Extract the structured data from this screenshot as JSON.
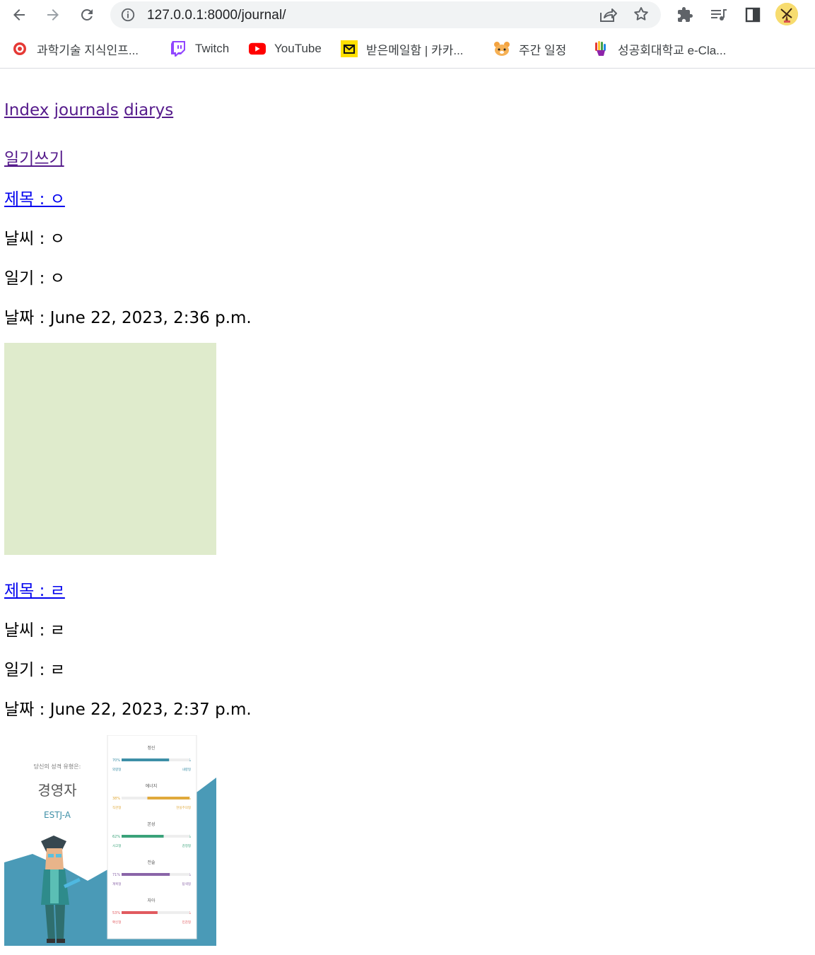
{
  "browser": {
    "url": "127.0.0.1:8000/journal/",
    "bookmarks": [
      {
        "label": "과학기술 지식인프...",
        "icon": "science-knowledge-icon"
      },
      {
        "label": "Twitch",
        "icon": "twitch-icon"
      },
      {
        "label": "YouTube",
        "icon": "youtube-icon"
      },
      {
        "label": "받은메일함 | 카카...",
        "icon": "kakao-mail-icon"
      },
      {
        "label": "주간 일정",
        "icon": "hamster-icon"
      },
      {
        "label": "성공회대학교 e-Cla...",
        "icon": "eclass-hand-icon"
      }
    ]
  },
  "nav": {
    "index": "Index",
    "journals": "journals",
    "diarys": "diarys",
    "write": "일기쓰기"
  },
  "entries": [
    {
      "title": "제목 : ㅇ",
      "weather": "날씨 : ㅇ",
      "diary": "일기 : ㅇ",
      "date": "날짜 : June 22, 2023, 2:36 p.m."
    },
    {
      "title": "제목 : ㄹ",
      "weather": "날씨 : ㄹ",
      "diary": "일기 : ㄹ",
      "date": "날짜 : June 22, 2023, 2:37 p.m."
    }
  ],
  "mbti_image": {
    "heading": "당신의 성격 유형은:",
    "type": "경영자",
    "code": "ESTJ-A",
    "traits": [
      {
        "name": "정신",
        "left": "70%",
        "right": "30%",
        "left_label": "외향형",
        "right_label": "내향형",
        "fill": 0.7,
        "color": "#3d8fa7",
        "side": "left"
      },
      {
        "name": "에너지",
        "left": "38%",
        "right": "62%",
        "left_label": "직관형",
        "right_label": "현실주의형",
        "fill": 0.62,
        "color": "#e0a93b",
        "side": "right"
      },
      {
        "name": "본성",
        "left": "62%",
        "right": "38%",
        "left_label": "사고형",
        "right_label": "감정형",
        "fill": 0.62,
        "color": "#3aa27a",
        "side": "left"
      },
      {
        "name": "전술",
        "left": "71%",
        "right": "29%",
        "left_label": "계획형",
        "right_label": "탐색형",
        "fill": 0.71,
        "color": "#8a65a8",
        "side": "left"
      },
      {
        "name": "자아",
        "left": "53%",
        "right": "47%",
        "left_label": "확신형",
        "right_label": "민감형",
        "fill": 0.53,
        "color": "#e15a5f",
        "side": "left"
      }
    ]
  }
}
